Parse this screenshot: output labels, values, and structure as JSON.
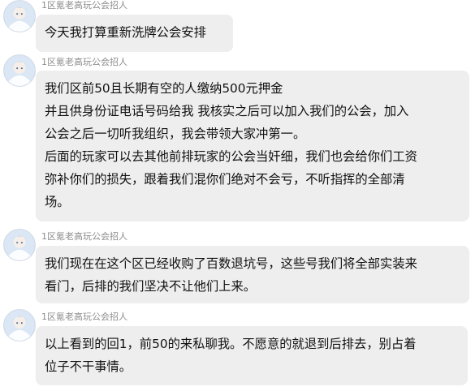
{
  "messages": [
    {
      "sender": "1区氪老高玩公会招人",
      "lines": [
        "今天我打算重新洗牌公会安排"
      ]
    },
    {
      "sender": "1区氪老高玩公会招人",
      "lines": [
        "我们区前50且长期有空的人缴纳500元押金",
        "并且供身份证电话号码给我 我核实之后可以加入我们的公会，加入",
        "公会之后一切听我组织，我会带领大家冲第一。",
        "后面的玩家可以去其他前排玩家的公会当奸细，我们也会给你们工资",
        "弥补你们的损失，跟着我们混你们绝对不会亏，不听指挥的全部清",
        "场。"
      ]
    },
    {
      "sender": "1区氪老高玩公会招人",
      "lines": [
        "我们现在在这个区已经收购了百数退坑号，这些号我们将全部实装来",
        "看门，后排的我们坚决不让他们上来。"
      ]
    },
    {
      "sender": "1区氪老高玩公会招人",
      "lines": [
        "以上看到的回1，前50的来私聊我。不愿意的就退到后排去，别占着",
        "位子不干事情。"
      ]
    }
  ],
  "colors": {
    "bubble": "#eeeeee",
    "sender_text": "#8c8c8c",
    "message_text": "#111111"
  },
  "avatar_icon": "anime-character-avatar-icon"
}
